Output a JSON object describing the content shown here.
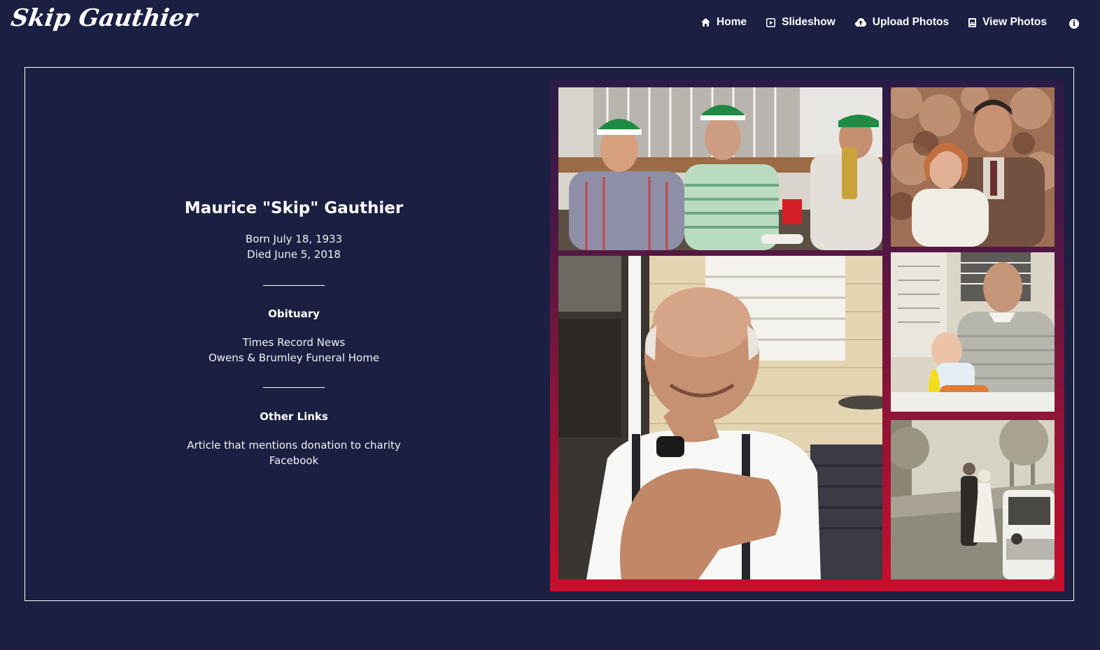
{
  "site": {
    "logo_text": "Skip Gauthier"
  },
  "nav": {
    "items": [
      {
        "label": "Home",
        "icon": "home-icon"
      },
      {
        "label": "Slideshow",
        "icon": "slideshow-icon"
      },
      {
        "label": "Upload Photos",
        "icon": "cloud-upload-icon"
      },
      {
        "label": "View Photos",
        "icon": "photo-album-icon"
      }
    ],
    "info_icon": "info-icon",
    "info_glyph": "i"
  },
  "person": {
    "name": "Maurice \"Skip\" Gauthier",
    "born": "Born July 18, 1933",
    "died": "Died June 5, 2018"
  },
  "obituary": {
    "title": "Obituary",
    "links": [
      "Times Record News",
      "Owens & Brumley Funeral Home"
    ]
  },
  "other_links": {
    "title": "Other Links",
    "links": [
      "Article that mentions donation to charity",
      "Facebook"
    ]
  },
  "colors": {
    "background": "#1b2043",
    "collage_gradient_top": "#2a1c46",
    "collage_gradient_bottom": "#c90f2c",
    "text": "#ffffff"
  },
  "photos": [
    {
      "name": "photo-party-green-hats"
    },
    {
      "name": "photo-couple-portrait"
    },
    {
      "name": "photo-smiling-man-porch"
    },
    {
      "name": "photo-man-with-baby"
    },
    {
      "name": "photo-vintage-wedding-street"
    }
  ]
}
